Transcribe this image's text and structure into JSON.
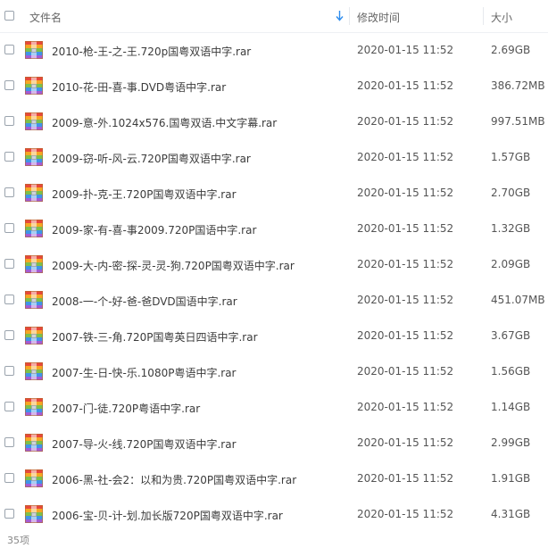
{
  "header": {
    "name_col": "文件名",
    "date_col": "修改时间",
    "size_col": "大小",
    "sort_icon": "sort-down-arrow-icon"
  },
  "file_icon": "rar-archive-icon",
  "colors": {
    "accent": "#2f8ded",
    "icon_colors": [
      "#e8473b",
      "#f6a623",
      "#7cc04b",
      "#3f94e8",
      "#a25bd6"
    ]
  },
  "files": [
    {
      "name": "2010-枪-王-之-王.720p国粤双语中字.rar",
      "modified": "2020-01-15 11:52",
      "size": "2.69GB"
    },
    {
      "name": "2010-花-田-喜-事.DVD粤语中字.rar",
      "modified": "2020-01-15 11:52",
      "size": "386.72MB"
    },
    {
      "name": "2009-意-外.1024x576.国粤双语.中文字幕.rar",
      "modified": "2020-01-15 11:52",
      "size": "997.51MB"
    },
    {
      "name": "2009-窃-听-风-云.720P国粤双语中字.rar",
      "modified": "2020-01-15 11:52",
      "size": "1.57GB"
    },
    {
      "name": "2009-扑-克-王.720P国粤双语中字.rar",
      "modified": "2020-01-15 11:52",
      "size": "2.70GB"
    },
    {
      "name": "2009-家-有-喜-事2009.720P国语中字.rar",
      "modified": "2020-01-15 11:52",
      "size": "1.32GB"
    },
    {
      "name": "2009-大-内-密-探-灵-灵-狗.720P国粤双语中字.rar",
      "modified": "2020-01-15 11:52",
      "size": "2.09GB"
    },
    {
      "name": "2008-一-个-好-爸-爸DVD国语中字.rar",
      "modified": "2020-01-15 11:52",
      "size": "451.07MB"
    },
    {
      "name": "2007-铁-三-角.720P国粤英日四语中字.rar",
      "modified": "2020-01-15 11:52",
      "size": "3.67GB"
    },
    {
      "name": "2007-生-日-快-乐.1080P粤语中字.rar",
      "modified": "2020-01-15 11:52",
      "size": "1.56GB"
    },
    {
      "name": "2007-门-徒.720P粤语中字.rar",
      "modified": "2020-01-15 11:52",
      "size": "1.14GB"
    },
    {
      "name": "2007-导-火-线.720P国粤双语中字.rar",
      "modified": "2020-01-15 11:52",
      "size": "2.99GB"
    },
    {
      "name": "2006-黑-社-会2：以和为贵.720P国粤双语中字.rar",
      "modified": "2020-01-15 11:52",
      "size": "1.91GB"
    },
    {
      "name": "2006-宝-贝-计-划.加长版720P国粤双语中字.rar",
      "modified": "2020-01-15 11:52",
      "size": "4.31GB"
    }
  ],
  "footer": {
    "count_label": "35项"
  }
}
